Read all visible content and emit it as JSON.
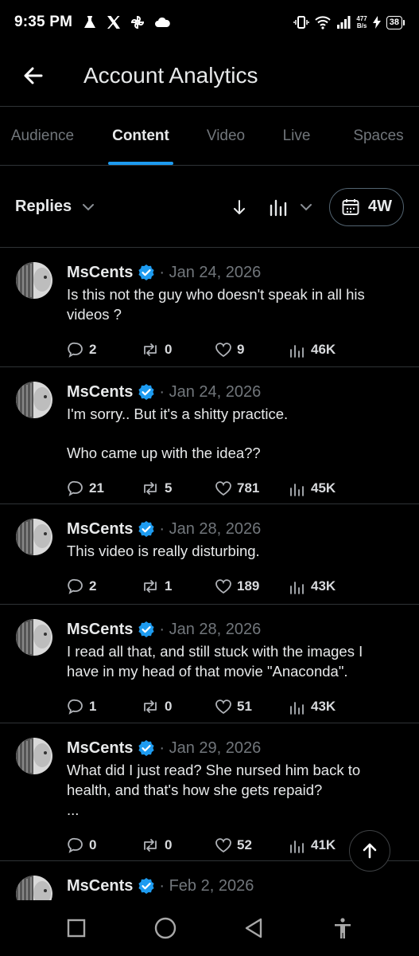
{
  "status_bar": {
    "time": "9:35 PM",
    "speed_value": "477",
    "speed_unit": "B/s",
    "battery": "38"
  },
  "header": {
    "title": "Account Analytics"
  },
  "tabs": [
    {
      "label": "Audience",
      "active": false
    },
    {
      "label": "Content",
      "active": true
    },
    {
      "label": "Video",
      "active": false
    },
    {
      "label": "Live",
      "active": false
    },
    {
      "label": "Spaces",
      "active": false
    }
  ],
  "filter": {
    "selected": "Replies",
    "period": "4W"
  },
  "posts": [
    {
      "author": "MsCents",
      "date": "· Jan 24, 2026",
      "text": [
        "Is this not the guy who doesn't speak in all his videos ?"
      ],
      "replies": "2",
      "reposts": "0",
      "likes": "9",
      "views": "46K"
    },
    {
      "author": "MsCents",
      "date": "· Jan 24, 2026",
      "text": [
        "I'm sorry.. But it's a shitty practice.",
        "Who came up with the idea??"
      ],
      "replies": "21",
      "reposts": "5",
      "likes": "781",
      "views": "45K"
    },
    {
      "author": "MsCents",
      "date": "· Jan 28, 2026",
      "text": [
        "This video is really disturbing."
      ],
      "replies": "2",
      "reposts": "1",
      "likes": "189",
      "views": "43K"
    },
    {
      "author": "MsCents",
      "date": "· Jan 28, 2026",
      "text": [
        "I read all that, and still stuck with the images I have in my head of that movie \"Anaconda\"."
      ],
      "replies": "1",
      "reposts": "0",
      "likes": "51",
      "views": "43K"
    },
    {
      "author": "MsCents",
      "date": "· Jan 29, 2026",
      "text": [
        "What did I just read? She nursed him back to health, and that's how she gets repaid?\n..."
      ],
      "replies": "0",
      "reposts": "0",
      "likes": "52",
      "views": "41K"
    },
    {
      "author": "MsCents",
      "date": "· Feb 2, 2026",
      "text": [],
      "replies": "",
      "reposts": "",
      "likes": "",
      "views": ""
    }
  ],
  "colors": {
    "accent": "#1d9bf0",
    "background": "#000000",
    "muted": "#71767b",
    "divider": "#2f3336"
  },
  "icons": {
    "back": "arrow-left-icon",
    "verified": "verified-badge-icon",
    "reply": "speech-bubble-icon",
    "repost": "repost-arrows-icon",
    "like": "heart-icon",
    "views": "bar-chart-icon",
    "sort": "arrow-down-icon",
    "calendar": "calendar-icon",
    "scroll_top": "arrow-up-icon"
  }
}
